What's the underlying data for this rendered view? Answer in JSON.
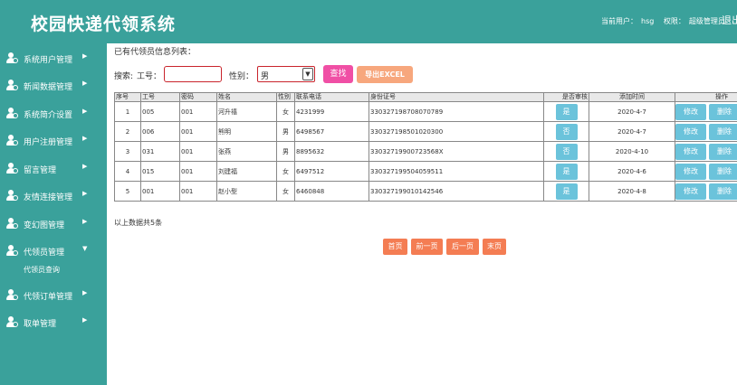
{
  "header": {
    "title": "校园快递代领系统",
    "current_user_label": "当前用户：",
    "current_user": "hsg",
    "role_label": "权限：",
    "role": "超级管理员",
    "logout": "退出"
  },
  "sidebar": {
    "items": [
      {
        "label": "系统用户管理",
        "arrow": "▶"
      },
      {
        "label": "新闻数据管理",
        "arrow": "▶"
      },
      {
        "label": "系统简介设置",
        "arrow": "▶"
      },
      {
        "label": "用户注册管理",
        "arrow": "▶"
      },
      {
        "label": "留言管理",
        "arrow": "▶"
      },
      {
        "label": "友情连接管理",
        "arrow": "▶"
      },
      {
        "label": "变幻图管理",
        "arrow": "▶"
      },
      {
        "label": "代领员管理",
        "arrow": "▼"
      },
      {
        "label": "代领订单管理",
        "arrow": "▶"
      },
      {
        "label": "取单管理",
        "arrow": "▶"
      }
    ],
    "subitem": "代领员查询"
  },
  "main": {
    "caption": "已有代领员信息列表：",
    "search": {
      "label": "搜索:",
      "id_label": "工号：",
      "id_value": "",
      "gender_label": "性别：",
      "gender_value": "男",
      "find_button": "查找",
      "export_button": "导出EXCEL"
    },
    "table": {
      "columns": [
        "序号",
        "工号",
        "密码",
        "姓名",
        "性别",
        "联系电话",
        "身份证号",
        "是否审核",
        "添加时间",
        "操作"
      ],
      "rows": [
        {
          "no": "1",
          "id": "005",
          "pwd": "001",
          "name": "河升禧",
          "gender": "女",
          "phone": "4231999",
          "idcard": "330327198708070789",
          "audit": "是",
          "time": "2020-4-7",
          "edit": "修改",
          "del": "删除"
        },
        {
          "no": "2",
          "id": "006",
          "pwd": "001",
          "name": "熊明",
          "gender": "男",
          "phone": "6498567",
          "idcard": "330327198501020300",
          "audit": "否",
          "time": "2020-4-7",
          "edit": "修改",
          "del": "删除"
        },
        {
          "no": "3",
          "id": "031",
          "pwd": "001",
          "name": "张燕",
          "gender": "男",
          "phone": "8895632",
          "idcard": "33032719900723568X",
          "audit": "否",
          "time": "2020-4-10",
          "edit": "修改",
          "del": "删除"
        },
        {
          "no": "4",
          "id": "015",
          "pwd": "001",
          "name": "刘建福",
          "gender": "女",
          "phone": "6497512",
          "idcard": "330327199504059511",
          "audit": "是",
          "time": "2020-4-6",
          "edit": "修改",
          "del": "删除"
        },
        {
          "no": "5",
          "id": "001",
          "pwd": "001",
          "name": "赵小型",
          "gender": "女",
          "phone": "6460848",
          "idcard": "330327199010142546",
          "audit": "是",
          "time": "2020-4-8",
          "edit": "修改",
          "del": "删除"
        }
      ]
    },
    "total": "以上数据共5条",
    "pager": {
      "first": "首页",
      "prev": "前一页",
      "next": "后一页",
      "last": "末页"
    }
  },
  "colors": {
    "theme": "#3aa19b",
    "find_button": "#f04fa5",
    "export_button": "#f7a77d",
    "pager_button": "#f47d53",
    "action_button": "#6bc3db"
  },
  "icons": {
    "sidebar_item": "user-gear-icon"
  }
}
